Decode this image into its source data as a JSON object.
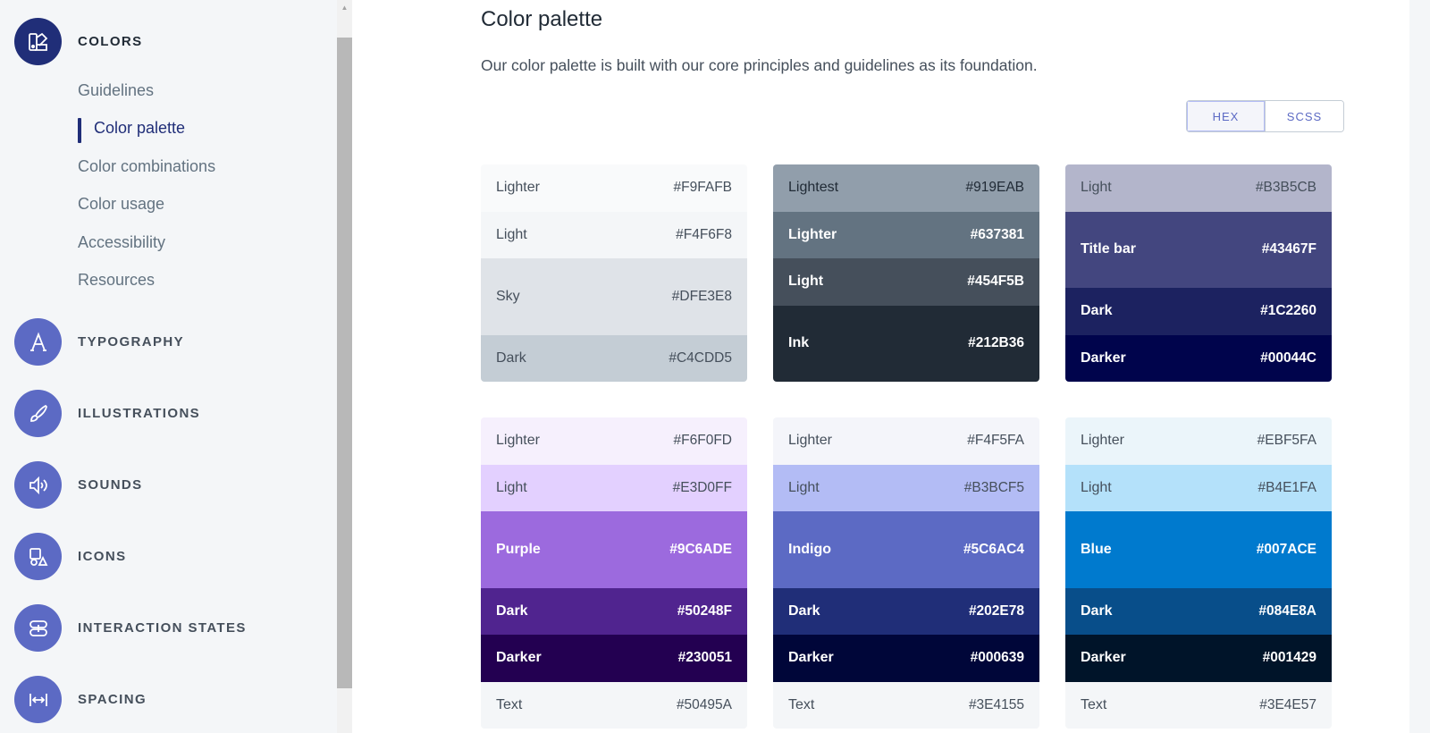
{
  "sidebar": {
    "sections": [
      {
        "id": "colors",
        "label": "COLORS",
        "icon": "color-swatch-icon",
        "active": true
      },
      {
        "id": "typography",
        "label": "TYPOGRAPHY",
        "icon": "typography-icon"
      },
      {
        "id": "illustrations",
        "label": "ILLUSTRATIONS",
        "icon": "brush-icon"
      },
      {
        "id": "sounds",
        "label": "SOUNDS",
        "icon": "speaker-icon"
      },
      {
        "id": "icons",
        "label": "ICONS",
        "icon": "shapes-icon"
      },
      {
        "id": "interaction-states",
        "label": "INTERACTION STATES",
        "icon": "interaction-icon"
      },
      {
        "id": "spacing",
        "label": "SPACING",
        "icon": "spacing-arrows-icon"
      }
    ],
    "subnav": [
      {
        "label": "Guidelines"
      },
      {
        "label": "Color palette",
        "current": true
      },
      {
        "label": "Color combinations"
      },
      {
        "label": "Color usage"
      },
      {
        "label": "Accessibility"
      },
      {
        "label": "Resources"
      }
    ]
  },
  "main": {
    "title": "Color palette",
    "description": "Our color palette is built with our core principles and guidelines as its foundation.",
    "format_toggle": [
      {
        "label": "HEX",
        "selected": true
      },
      {
        "label": "SCSS"
      }
    ]
  },
  "palette": [
    [
      {
        "name": "Lighter",
        "hex": "#F9FAFB",
        "bg": "#F9FAFB",
        "fg": "#454f5b"
      },
      {
        "name": "Light",
        "hex": "#F4F6F8",
        "bg": "#F4F6F8",
        "fg": "#454f5b"
      },
      {
        "name": "Sky",
        "hex": "#DFE3E8",
        "bg": "#DFE3E8",
        "fg": "#454f5b",
        "tall": true
      },
      {
        "name": "Dark",
        "hex": "#C4CDD5",
        "bg": "#C4CDD5",
        "fg": "#454f5b"
      }
    ],
    [
      {
        "name": "Lightest",
        "hex": "#919EAB",
        "bg": "#919EAB",
        "fg": "#212b36"
      },
      {
        "name": "Lighter",
        "hex": "#637381",
        "bg": "#637381",
        "fg": "#ffffff"
      },
      {
        "name": "Light",
        "hex": "#454F5B",
        "bg": "#454F5B",
        "fg": "#ffffff"
      },
      {
        "name": "Ink",
        "hex": "#212B36",
        "bg": "#212B36",
        "fg": "#ffffff",
        "tall": true
      }
    ],
    [
      {
        "name": "Light",
        "hex": "#B3B5CB",
        "bg": "#B3B5CB",
        "fg": "#454f5b"
      },
      {
        "name": "Title bar",
        "hex": "#43467F",
        "bg": "#43467F",
        "fg": "#ffffff",
        "tall": true
      },
      {
        "name": "Dark",
        "hex": "#1C2260",
        "bg": "#1C2260",
        "fg": "#ffffff"
      },
      {
        "name": "Darker",
        "hex": "#00044C",
        "bg": "#00044C",
        "fg": "#ffffff"
      }
    ],
    [
      {
        "name": "Lighter",
        "hex": "#F6F0FD",
        "bg": "#F6F0FD",
        "fg": "#454f5b"
      },
      {
        "name": "Light",
        "hex": "#E3D0FF",
        "bg": "#E3D0FF",
        "fg": "#454f5b"
      },
      {
        "name": "Purple",
        "hex": "#9C6ADE",
        "bg": "#9C6ADE",
        "fg": "#ffffff",
        "tall": true
      },
      {
        "name": "Dark",
        "hex": "#50248F",
        "bg": "#50248F",
        "fg": "#ffffff"
      },
      {
        "name": "Darker",
        "hex": "#230051",
        "bg": "#230051",
        "fg": "#ffffff"
      },
      {
        "name": "Text",
        "hex": "#50495A",
        "bg": "#F4F6F8",
        "fg": "#454f5b"
      }
    ],
    [
      {
        "name": "Lighter",
        "hex": "#F4F5FA",
        "bg": "#F4F5FA",
        "fg": "#454f5b"
      },
      {
        "name": "Light",
        "hex": "#B3BCF5",
        "bg": "#B3BCF5",
        "fg": "#454f5b"
      },
      {
        "name": "Indigo",
        "hex": "#5C6AC4",
        "bg": "#5C6AC4",
        "fg": "#ffffff",
        "tall": true
      },
      {
        "name": "Dark",
        "hex": "#202E78",
        "bg": "#202E78",
        "fg": "#ffffff"
      },
      {
        "name": "Darker",
        "hex": "#000639",
        "bg": "#000639",
        "fg": "#ffffff"
      },
      {
        "name": "Text",
        "hex": "#3E4155",
        "bg": "#F4F6F8",
        "fg": "#454f5b"
      }
    ],
    [
      {
        "name": "Lighter",
        "hex": "#EBF5FA",
        "bg": "#EBF5FA",
        "fg": "#454f5b"
      },
      {
        "name": "Light",
        "hex": "#B4E1FA",
        "bg": "#B4E1FA",
        "fg": "#454f5b"
      },
      {
        "name": "Blue",
        "hex": "#007ACE",
        "bg": "#007ACE",
        "fg": "#ffffff",
        "tall": true
      },
      {
        "name": "Dark",
        "hex": "#084E8A",
        "bg": "#084E8A",
        "fg": "#ffffff"
      },
      {
        "name": "Darker",
        "hex": "#001429",
        "bg": "#001429",
        "fg": "#ffffff"
      },
      {
        "name": "Text",
        "hex": "#3E4E57",
        "bg": "#F4F6F8",
        "fg": "#454f5b"
      }
    ]
  ]
}
